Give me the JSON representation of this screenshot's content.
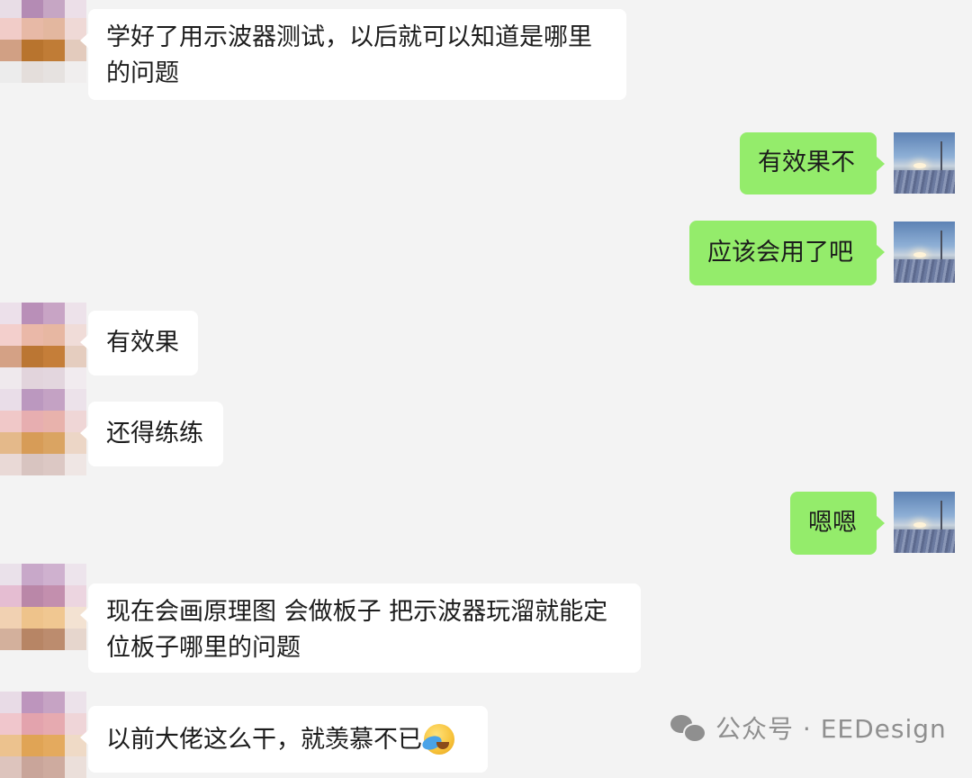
{
  "messages": [
    {
      "side": "left",
      "lines": [
        "学好了用示波器测试，以后就可以知道是哪里",
        "的问题"
      ]
    },
    {
      "side": "right",
      "lines": [
        "有效果不"
      ]
    },
    {
      "side": "right",
      "lines": [
        "应该会用了吧"
      ]
    },
    {
      "side": "left",
      "lines": [
        "有效果"
      ]
    },
    {
      "side": "left",
      "lines": [
        "还得练练"
      ]
    },
    {
      "side": "right",
      "lines": [
        "嗯嗯"
      ]
    },
    {
      "side": "left",
      "lines": [
        "现在会画原理图 会做板子 把示波器玩溜就能定",
        "位板子哪里的问题"
      ]
    },
    {
      "side": "left",
      "lines": [
        "以前大佬这么干，就羡慕不已"
      ],
      "emoji": "crying-laughing-emoji"
    }
  ],
  "watermark": {
    "icon": "wechat-icon",
    "text": "公众号 · EEDesign"
  },
  "colors": {
    "background": "#f3f3f3",
    "bubble_left": "#ffffff",
    "bubble_right": "#94ec6b",
    "watermark": "#8f8f8f"
  }
}
